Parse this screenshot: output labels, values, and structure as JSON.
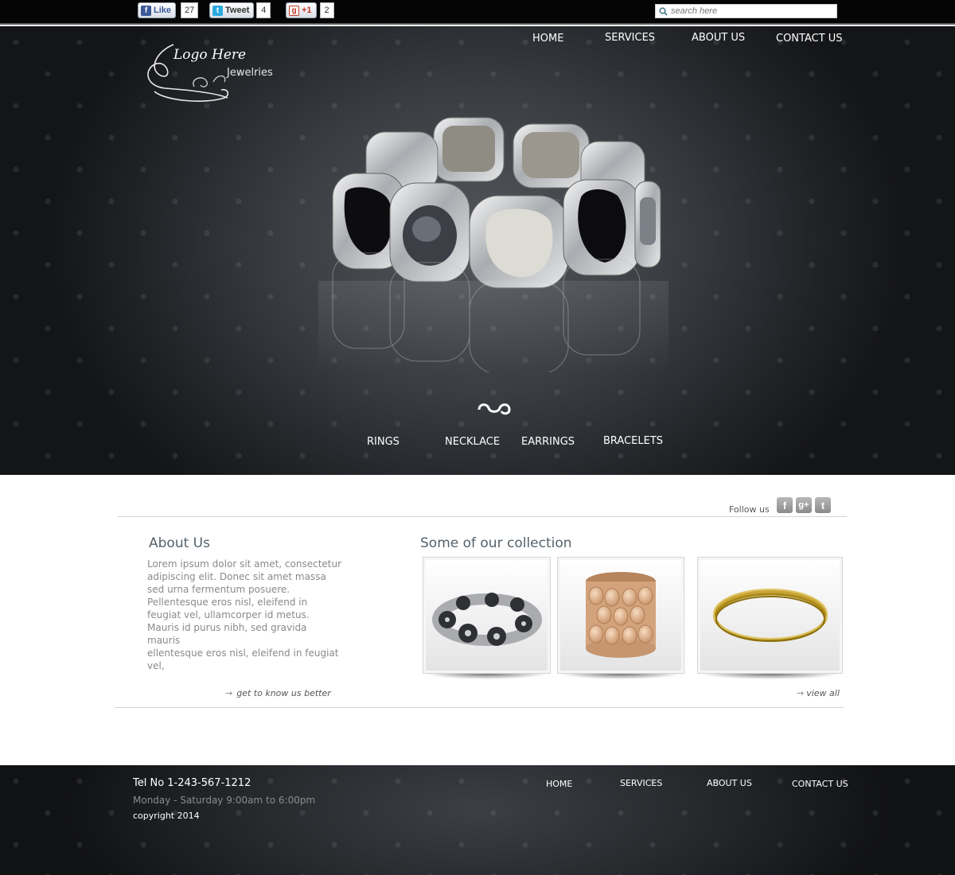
{
  "topbar": {
    "facebook": {
      "label": "Like",
      "count": "27"
    },
    "twitter": {
      "label": "Tweet",
      "count": "4"
    },
    "gplus": {
      "label": "+1",
      "count": "2"
    },
    "search": {
      "placeholder": "search here"
    }
  },
  "logo": {
    "line1": "Logo Here",
    "line2": "Jewelries"
  },
  "nav": {
    "home": "HOME",
    "services": "SERVICES",
    "about": "ABOUT US",
    "contact": "CONTACT US"
  },
  "categories": {
    "rings": "RINGS",
    "necklace": "NECKLACE",
    "earrings": "EARRINGS",
    "bracelets": "BRACELETS"
  },
  "follow": {
    "label": "Follow us",
    "icons": [
      "facebook-icon",
      "google-plus-icon",
      "twitter-icon"
    ]
  },
  "about": {
    "title": "About Us",
    "text": "Lorem ipsum dolor sit amet, consectetur adipiscing elit. Donec sit amet massa sed urna fermentum posuere. Pellentesque eros nisl, eleifend in feugiat vel, ullamcorper id metus. Mauris id purus nibh, sed gravida mauris",
    "text2": "ellentesque eros nisl, eleifend in feugiat vel,",
    "link": "get to know us better"
  },
  "collection": {
    "title": "Some of our collection",
    "link": "view all",
    "items": [
      "silver-flower-bracelet",
      "gold-disc-cuff",
      "gold-bangles"
    ]
  },
  "footer": {
    "tel": "Tel No 1-243-567-1212",
    "hours": "Monday - Saturday 9:00am to 6:00pm",
    "copyright": "copyright 2014",
    "nav": {
      "home": "HOME",
      "services": "SERVICES",
      "about": "ABOUT US",
      "contact": "CONTACT US"
    }
  },
  "colors": {
    "hero_dark": "#2a2c30",
    "heading": "#55626a",
    "body_text": "#8a8a8a"
  }
}
